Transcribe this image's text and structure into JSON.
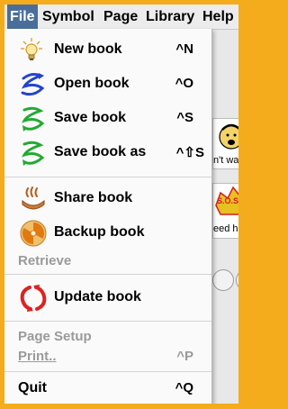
{
  "menubar": {
    "items": [
      "File",
      "Symbol",
      "Page",
      "Library",
      "Help"
    ]
  },
  "file_menu": {
    "items": [
      {
        "label": "New book",
        "shortcut": "^N",
        "icon": "lightbulb-icon"
      },
      {
        "label": "Open book",
        "shortcut": "^O",
        "icon": "blue-swirl-icon"
      },
      {
        "label": "Save book",
        "shortcut": "^S",
        "icon": "green-swirl-icon"
      },
      {
        "label": "Save book as",
        "shortcut": "^⇧S",
        "icon": "green-swirl-icon"
      },
      {
        "label": "Share book",
        "icon": "share-hand-icon"
      },
      {
        "label": "Backup book",
        "icon": "radiation-icon"
      },
      {
        "label": "Retrieve",
        "disabled": true
      },
      {
        "label": "Update book",
        "icon": "red-arrows-icon"
      },
      {
        "label": "Page Setup",
        "disabled": true
      },
      {
        "label": "Print..",
        "shortcut": "^P",
        "disabled": true
      },
      {
        "label": "Quit",
        "shortcut": "^Q"
      }
    ]
  },
  "background": {
    "snippets": [
      "n't wa",
      "S.O.S",
      "eed he"
    ]
  },
  "colors": {
    "frame": "#f4ac1c",
    "menu_active": "#4a6e9a",
    "disabled": "#9a9a9a"
  }
}
